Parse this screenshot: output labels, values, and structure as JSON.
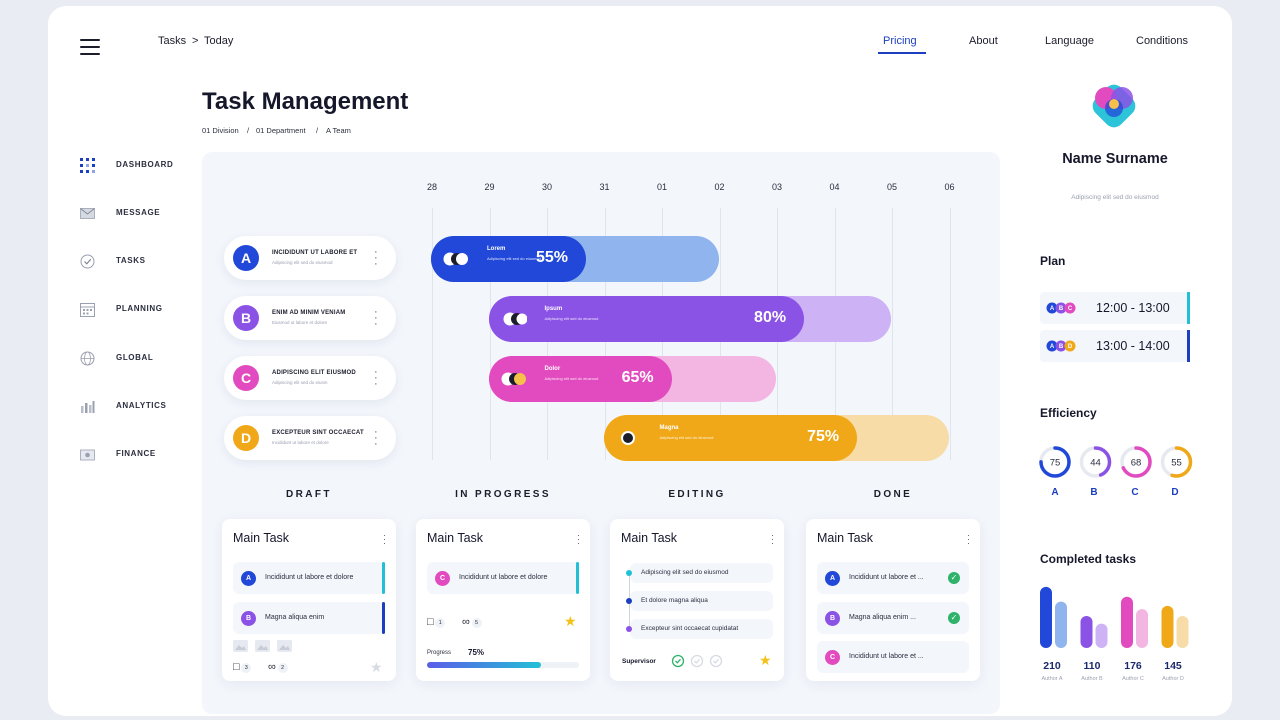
{
  "header": {
    "breadcrumb": [
      "Tasks",
      ">",
      "Today"
    ],
    "nav": [
      "Pricing",
      "About",
      "Language",
      "Conditions"
    ]
  },
  "sidebar": {
    "items": [
      {
        "label": "DASHBOARD",
        "icon": "dashboard-grid-icon"
      },
      {
        "label": "MESSAGE",
        "icon": "envelope-icon"
      },
      {
        "label": "TASKS",
        "icon": "check-circle-icon"
      },
      {
        "label": "PLANNING",
        "icon": "calendar-icon"
      },
      {
        "label": "GLOBAL",
        "icon": "globe-icon"
      },
      {
        "label": "ANALYTICS",
        "icon": "bar-chart-icon"
      },
      {
        "label": "FINANCE",
        "icon": "wallet-icon"
      }
    ]
  },
  "page": {
    "title": "Task Management",
    "crumbs": [
      "01 Division",
      "/",
      "01 Department",
      "/",
      "A Team"
    ]
  },
  "timeline": {
    "days": [
      "28",
      "29",
      "30",
      "31",
      "01",
      "02",
      "03",
      "04",
      "05",
      "06"
    ],
    "tasks": [
      {
        "letter": "A",
        "title": "INCIDIDUNT UT LABORE ET",
        "subtitle": "Adipiscing elit sed do eiusmod",
        "color": "#2148d8"
      },
      {
        "letter": "B",
        "title": "ENIM AD MINIM VENIAM",
        "subtitle": "Eiusmod ut labore et dolore",
        "color": "#8b52e6"
      },
      {
        "letter": "C",
        "title": "ADIPISCING ELIT EIUSMOD",
        "subtitle": "Adipiscing elit sed do eiusm",
        "color": "#e24bbf"
      },
      {
        "letter": "D",
        "title": "EXCEPTEUR SINT OCCAECAT",
        "subtitle": "Incididunt ut labore et dolore",
        "color": "#f0a818"
      }
    ],
    "bars": [
      {
        "name": "Lorem",
        "desc": "Adipiscing elit sed do eiusmod",
        "percent": "55%",
        "progress": 0.55,
        "start": 0,
        "span": 5,
        "fg": "#2148d8",
        "bg": "#8fb4ee"
      },
      {
        "name": "Ipsum",
        "desc": "Adipiscing elit sed do eiusmod",
        "percent": "80%",
        "progress": 0.8,
        "start": 1,
        "span": 7,
        "fg": "#8b52e6",
        "bg": "#cdb3f5"
      },
      {
        "name": "Dolor",
        "desc": "Adipiscing elit sed do eiusmod",
        "percent": "65%",
        "progress": 0.65,
        "start": 1,
        "span": 5,
        "fg": "#e24bbf",
        "bg": "#f3b6e2"
      },
      {
        "name": "Magna",
        "desc": "Adipiscing elit sed do eiusmod",
        "percent": "75%",
        "progress": 0.75,
        "start": 3,
        "span": 6,
        "fg": "#f0a818",
        "bg": "#f7dca8"
      }
    ]
  },
  "board": {
    "columns": [
      "DRAFT",
      "IN PROGRESS",
      "EDITING",
      "DONE"
    ],
    "draft": {
      "title": "Main Task",
      "items": [
        {
          "letter": "A",
          "text": "Incididunt ut labore et dolore"
        },
        {
          "letter": "B",
          "text": "Magna aliqua enim"
        }
      ],
      "comments": "3",
      "attachments": "2"
    },
    "progress": {
      "title": "Main Task",
      "item": {
        "letter": "C",
        "text": "Incididunt ut labore et dolore"
      },
      "comments": "1",
      "attachments": "5",
      "progress_label": "Progress",
      "progress_value": "75%",
      "progress": 0.75
    },
    "editing": {
      "title": "Main Task",
      "items": [
        "Adipiscing elit sed do eiusmod",
        "Et dolore magna aliqua",
        "Excepteur sint occaecat cupidatat"
      ],
      "supervisor_label": "Supervisor"
    },
    "done": {
      "title": "Main Task",
      "items": [
        {
          "letter": "A",
          "text": "Incididunt ut labore et ..."
        },
        {
          "letter": "B",
          "text": "Magna aliqua enim ..."
        },
        {
          "letter": "C",
          "text": "Incididunt ut labore et ..."
        }
      ]
    }
  },
  "profile": {
    "name": "Name Surname",
    "subtitle": "Adipiscing elit sed do eiusmod"
  },
  "plan": {
    "title": "Plan",
    "rows": [
      {
        "time": "12:00 - 13:00",
        "edge": "#22c0d6"
      },
      {
        "time": "13:00 - 14:00",
        "edge": "#1b3fbf"
      }
    ]
  },
  "efficiency": {
    "title": "Efficiency",
    "items": [
      {
        "label": "A",
        "value": "75",
        "frac": 0.75,
        "color": "#2148d8"
      },
      {
        "label": "B",
        "value": "44",
        "frac": 0.44,
        "color": "#8b52e6"
      },
      {
        "label": "C",
        "value": "68",
        "frac": 0.68,
        "color": "#e24bbf"
      },
      {
        "label": "D",
        "value": "55",
        "frac": 0.55,
        "color": "#f0a818"
      }
    ]
  },
  "completed": {
    "title": "Completed tasks",
    "chart_data": {
      "type": "bar",
      "categories": [
        "Author A",
        "Author B",
        "Author C",
        "Author D"
      ],
      "values": [
        210,
        110,
        176,
        145
      ],
      "colors": [
        [
          "#2148d8",
          "#8fb4ee"
        ],
        [
          "#8b52e6",
          "#cdb3f5"
        ],
        [
          "#e24bbf",
          "#f3b6e2"
        ],
        [
          "#f0a818",
          "#f7dca8"
        ]
      ],
      "ylim": [
        0,
        220
      ]
    }
  }
}
